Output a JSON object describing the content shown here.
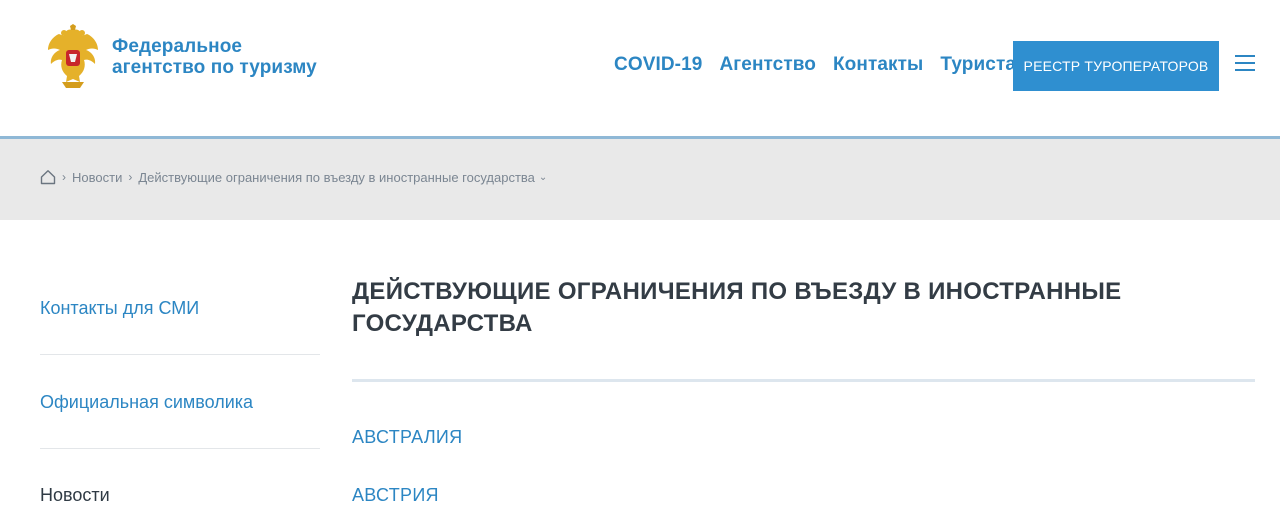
{
  "header": {
    "brand_line1": "Федеральное",
    "brand_line2": "агентство по туризму",
    "nav": [
      "COVID-19",
      "Агентство",
      "Контакты",
      "Туристам"
    ],
    "cta_label": "РЕЕСТР ТУРОПЕРАТОРОВ",
    "accent": "#2c86c3",
    "cta_color": "#2f8fd0"
  },
  "breadcrumb": {
    "home_icon": "home-icon",
    "items": [
      "Новости",
      "Действующие ограничения по въезду в иностранные государства"
    ]
  },
  "sidebar": {
    "items": [
      "Контакты для СМИ",
      "Официальная символика",
      "Новости"
    ]
  },
  "main": {
    "title_line1": "ДЕЙСТВУЮЩИЕ ОГРАНИЧЕНИЯ ПО ВЪЕЗДУ В ИНОСТРАННЫЕ",
    "title_line2": "ГОСУДАРСТВА",
    "countries": [
      "АВСТРАЛИЯ",
      "АВСТРИЯ"
    ]
  }
}
